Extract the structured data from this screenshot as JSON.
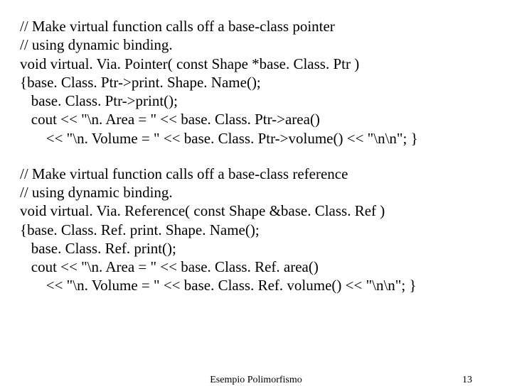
{
  "block1": {
    "l1": "// Make virtual function calls off a base-class pointer",
    "l2": "// using dynamic binding.",
    "l3": "void virtual. Via. Pointer( const Shape *base. Class. Ptr )",
    "l4": "{base. Class. Ptr->print. Shape. Name();",
    "l5": "   base. Class. Ptr->print();",
    "l6": "   cout << \"\\n. Area = \" << base. Class. Ptr->area()",
    "l7": "       << \"\\n. Volume = \" << base. Class. Ptr->volume() << \"\\n\\n\"; }"
  },
  "block2": {
    "l1": "// Make virtual function calls off a base-class reference",
    "l2": "// using dynamic binding.",
    "l3": "void virtual. Via. Reference( const Shape &base. Class. Ref )",
    "l4": "{base. Class. Ref. print. Shape. Name();",
    "l5": "   base. Class. Ref. print();",
    "l6": "   cout << \"\\n. Area = \" << base. Class. Ref. area()",
    "l7": "       << \"\\n. Volume = \" << base. Class. Ref. volume() << \"\\n\\n\"; }"
  },
  "footer": {
    "title": "Esempio Polimorfismo",
    "page": "13"
  }
}
